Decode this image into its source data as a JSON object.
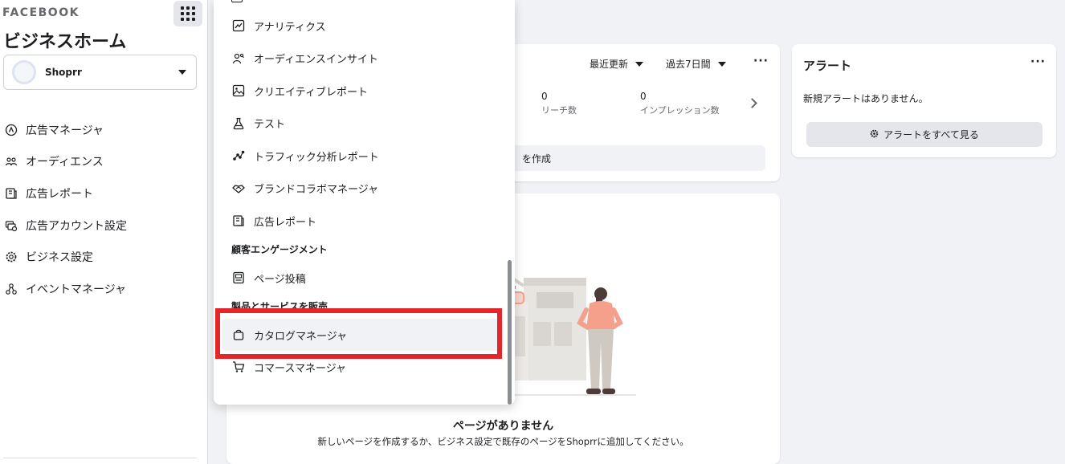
{
  "sidebar": {
    "brand": "FACEBOOK",
    "title": "ビジネスホーム",
    "account_name": "Shoprr",
    "items": [
      {
        "label": "広告マネージャ",
        "icon": "ads-manager-icon"
      },
      {
        "label": "オーディエンス",
        "icon": "audience-icon"
      },
      {
        "label": "広告レポート",
        "icon": "ads-report-icon"
      },
      {
        "label": "広告アカウント設定",
        "icon": "ad-account-settings-icon"
      },
      {
        "label": "ビジネス設定",
        "icon": "gear-icon"
      },
      {
        "label": "イベントマネージャ",
        "icon": "events-manager-icon"
      }
    ]
  },
  "performance": {
    "filter_recent": "最近更新",
    "filter_period": "過去7日間",
    "metrics": [
      {
        "value": "0",
        "label": "リーチ数"
      },
      {
        "value": "0",
        "label": "インプレッション数"
      }
    ],
    "create_label": "を作成"
  },
  "alerts": {
    "title": "アラート",
    "empty_text": "新規アラートはありません。",
    "button_label": "アラートをすべて見る"
  },
  "pages": {
    "empty_title": "ページがありません",
    "empty_desc": "新しいページを作成するか、ビジネス設定で既存のページをShoprrに追加してください。"
  },
  "menu": {
    "items_analyze": [
      {
        "label": "アナリティクス",
        "icon": "analytics-icon"
      },
      {
        "label": "オーディエンスインサイト",
        "icon": "audience-insights-icon"
      },
      {
        "label": "クリエイティブレポート",
        "icon": "creative-report-icon"
      },
      {
        "label": "テスト",
        "icon": "flask-icon"
      },
      {
        "label": "トラフィック分析レポート",
        "icon": "traffic-analysis-icon"
      },
      {
        "label": "ブランドコラボマネージャ",
        "icon": "handshake-icon"
      },
      {
        "label": "広告レポート",
        "icon": "ads-report-icon"
      }
    ],
    "section_engagement": "顧客エンゲージメント",
    "items_engagement": [
      {
        "label": "ページ投稿",
        "icon": "page-posts-icon"
      }
    ],
    "section_sell": "製品とサービスを販売",
    "items_sell": [
      {
        "label": "カタログマネージャ",
        "icon": "shopping-bag-icon"
      },
      {
        "label": "コマースマネージャ",
        "icon": "cart-icon"
      }
    ]
  },
  "colors": {
    "highlight": "#e4252a",
    "background": "#f0f2f5",
    "illustration_accent": "#f4a08a"
  }
}
